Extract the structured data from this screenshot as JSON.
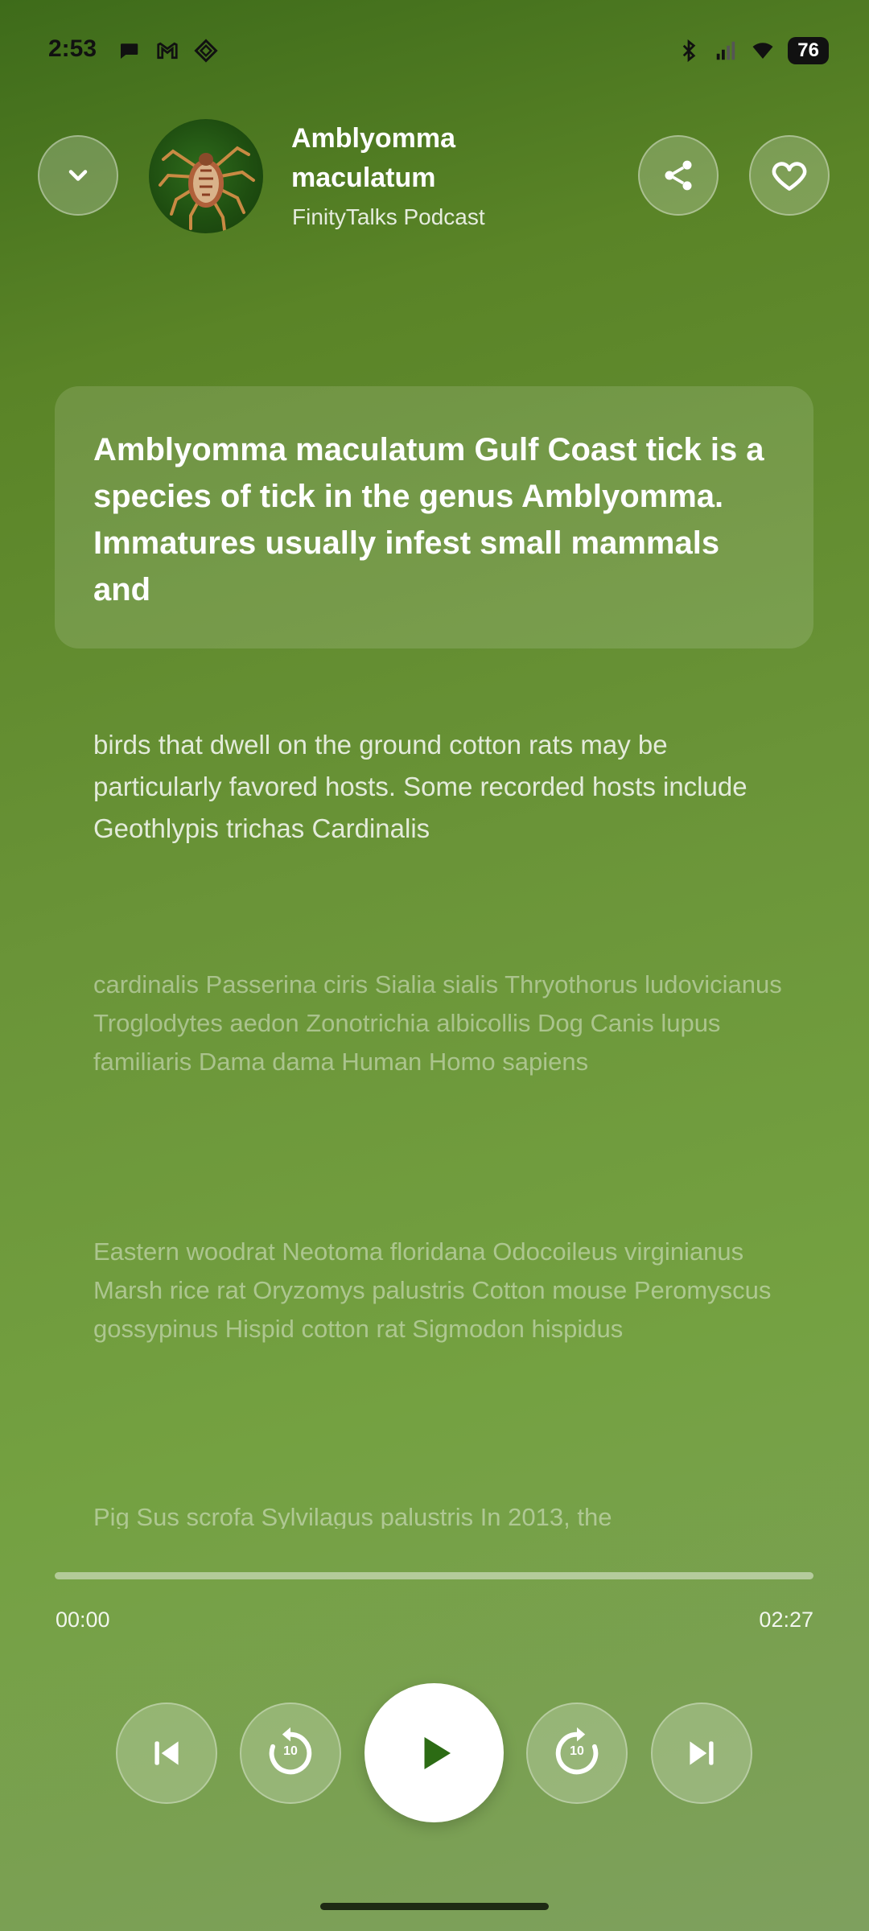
{
  "status_bar": {
    "time": "2:53",
    "battery": "76",
    "left_icons": [
      "message-icon",
      "gmail-icon",
      "app-icon"
    ],
    "right_icons": [
      "bluetooth-icon",
      "signal-icon",
      "wifi-icon",
      "battery-icon"
    ]
  },
  "header": {
    "title": "Amblyomma maculatum",
    "podcast": "FinityTalks Podcast",
    "collapse_icon": "chevron-down-icon",
    "share_icon": "share-icon",
    "like_icon": "heart-icon"
  },
  "transcript": {
    "active": "Amblyomma maculatum Gulf Coast tick is a species of tick in the genus Amblyomma. Immatures usually infest small mammals and",
    "segments": [
      "birds that dwell on the ground cotton rats may be particularly favored hosts. Some recorded hosts include Geothlypis trichas Cardinalis",
      "cardinalis Passerina ciris Sialia sialis Thryothorus ludovicianus Troglodytes aedon Zonotrichia albicollis Dog Canis lupus familiaris Dama dama Human Homo sapiens",
      "Eastern woodrat Neotoma floridana Odocoileus virginianus Marsh rice rat Oryzomys palustris Cotton mouse Peromyscus gossypinus Hispid cotton rat Sigmodon hispidus",
      "Pig Sus scrofa Sylvilagus palustris In 2013, the"
    ]
  },
  "player": {
    "current_time": "00:00",
    "total_time": "02:27",
    "progress_fraction": 0,
    "skip_back_label": "10",
    "skip_forward_label": "10"
  },
  "colors": {
    "accent": "#2c6b14",
    "background_top": "#3e6b1a",
    "background_bottom": "#7ea05e"
  }
}
